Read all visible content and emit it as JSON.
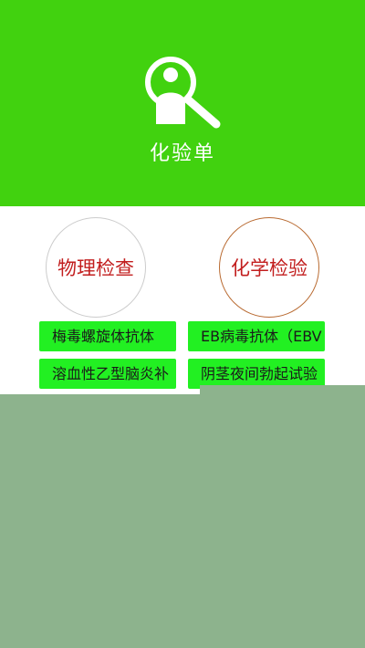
{
  "header": {
    "title": "化验单",
    "icon": "search-person-icon",
    "background_color": "#41d20f"
  },
  "categories": [
    {
      "label": "物理检查",
      "border_color": "#cccccc",
      "text_color": "#c21e1e"
    },
    {
      "label": "化学检验",
      "border_color": "#b96b32",
      "text_color": "#c21e1e"
    }
  ],
  "tests": {
    "left": [
      "梅毒螺旋体抗体",
      "溶血性乙型脑炎补"
    ],
    "right": [
      "EB病毒抗体（EBV",
      "阴茎夜间勃起试验"
    ]
  },
  "overlay_color": "#8db38d",
  "button_color": "#22f022"
}
